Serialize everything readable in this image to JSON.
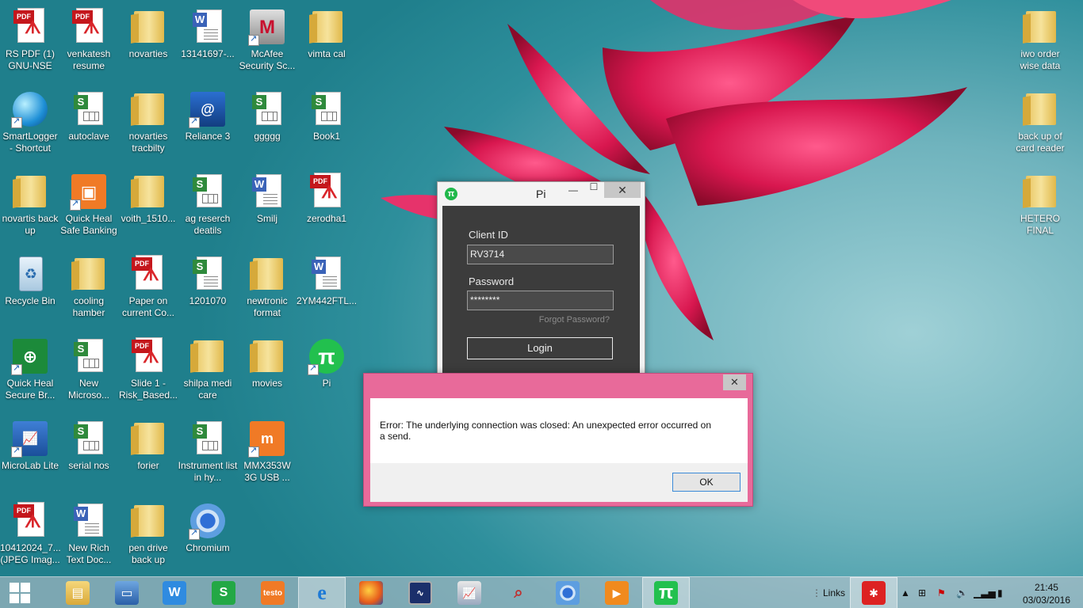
{
  "desktop": {
    "col1": [
      {
        "label": "RS PDF (1) GNU-NSE S...",
        "type": "pdf"
      },
      {
        "label": "SmartLogger - Shortcut",
        "type": "globe"
      },
      {
        "label": "novartis back up",
        "type": "folder"
      },
      {
        "label": "Recycle Bin",
        "type": "bin"
      },
      {
        "label": "Quick Heal Secure Br...",
        "type": "qh"
      },
      {
        "label": "MicroLab Lite",
        "type": "app"
      },
      {
        "label": "10412024_7... (JPEG Imag...",
        "type": "pdf"
      }
    ],
    "col2": [
      {
        "label": "venkatesh resume",
        "type": "pdf"
      },
      {
        "label": "autoclave",
        "type": "sheet"
      },
      {
        "label": "Quick Heal Safe Banking",
        "type": "qhbank"
      },
      {
        "label": "cooling hamber",
        "type": "folder"
      },
      {
        "label": "New Microso...",
        "type": "sheet"
      },
      {
        "label": "serial nos",
        "type": "sheet"
      },
      {
        "label": "New Rich Text Doc...",
        "type": "word"
      }
    ],
    "col3": [
      {
        "label": "novarties",
        "type": "folder"
      },
      {
        "label": "novarties tracbilty",
        "type": "folder"
      },
      {
        "label": "voith_1510...",
        "type": "folder"
      },
      {
        "label": "Paper on current Co...",
        "type": "pdf"
      },
      {
        "label": "Slide 1 - Risk_Based...",
        "type": "pdf"
      },
      {
        "label": "forier",
        "type": "folder"
      },
      {
        "label": "pen drive back up",
        "type": "folder"
      }
    ],
    "col4": [
      {
        "label": "13141697-...",
        "type": "word"
      },
      {
        "label": "Reliance 3",
        "type": "reliance"
      },
      {
        "label": "ag reserch deatils",
        "type": "sheet"
      },
      {
        "label": "1201070",
        "type": "sheet"
      },
      {
        "label": "shilpa medi care",
        "type": "folder"
      },
      {
        "label": "Instrument list in hy...",
        "type": "sheet"
      },
      {
        "label": "Chromium",
        "type": "chromium"
      }
    ],
    "col5": [
      {
        "label": "McAfee Security Sc...",
        "type": "mcafee"
      },
      {
        "label": "ggggg",
        "type": "sheet"
      },
      {
        "label": "Smilj",
        "type": "word"
      },
      {
        "label": "newtronic format",
        "type": "folder"
      },
      {
        "label": "movies",
        "type": "folder"
      },
      {
        "label": "MMX353W 3G USB ...",
        "type": "mmx"
      }
    ],
    "col6": [
      {
        "label": "vimta cal",
        "type": "folder"
      },
      {
        "label": "Book1",
        "type": "sheet"
      },
      {
        "label": "zerodha1",
        "type": "pdf"
      },
      {
        "label": "2YM442FTL...",
        "type": "word"
      },
      {
        "label": "Pi",
        "type": "pi"
      }
    ],
    "right": [
      {
        "label": "iwo order wise data",
        "type": "folder"
      },
      {
        "label": "back up of card reader",
        "type": "folder"
      },
      {
        "label": "HETERO FINAL",
        "type": "folder"
      }
    ]
  },
  "pi_window": {
    "title": "Pi",
    "minimize": "—",
    "maximize": "☐",
    "close": "✕",
    "client_id_label": "Client ID",
    "client_id_value": "RV3714",
    "password_label": "Password",
    "password_value": "********",
    "forgot": "Forgot Password?",
    "login": "Login"
  },
  "error_dialog": {
    "close": "✕",
    "message": "Error: The underlying connection was closed: An unexpected error occurred on a send.",
    "ok": "OK"
  },
  "taskbar": {
    "links": "Links",
    "time": "21:45",
    "date": "03/03/2016"
  }
}
